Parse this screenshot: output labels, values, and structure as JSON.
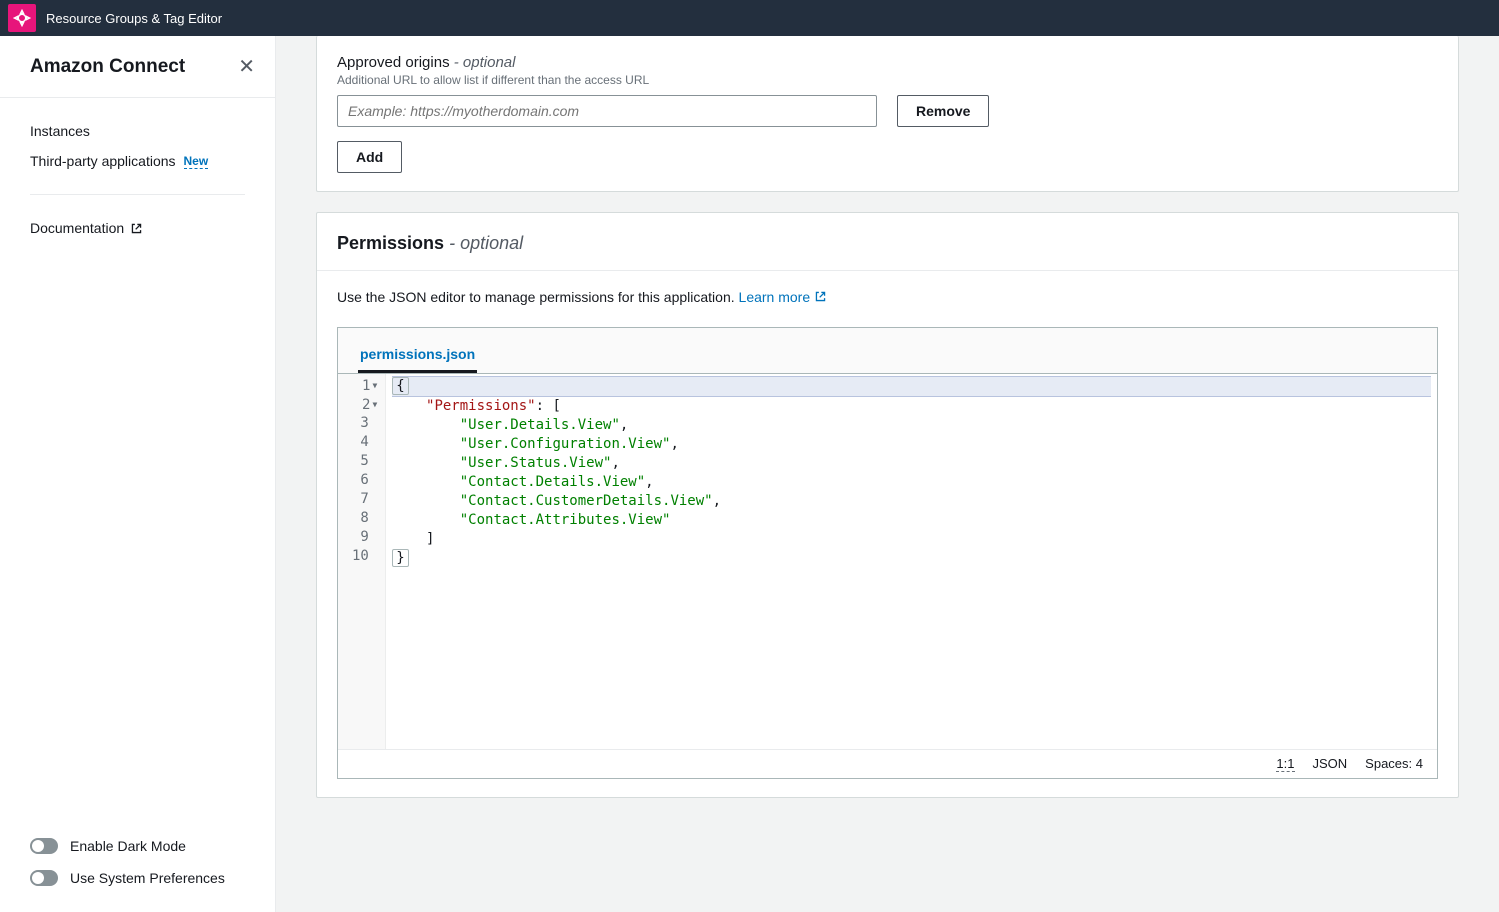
{
  "header": {
    "title": "Resource Groups & Tag Editor"
  },
  "sidebar": {
    "title": "Amazon Connect",
    "items": [
      {
        "label": "Instances"
      },
      {
        "label": "Third-party applications",
        "badge": "New"
      }
    ],
    "doc_label": "Documentation",
    "dark_mode_label": "Enable Dark Mode",
    "system_pref_label": "Use System Preferences"
  },
  "origins": {
    "title": "Approved origins",
    "optional_marker": "- optional",
    "description": "Additional URL to allow list if different than the access URL",
    "placeholder": "Example: https://myotherdomain.com",
    "remove_label": "Remove",
    "add_label": "Add"
  },
  "permissions": {
    "title": "Permissions",
    "optional_marker": "- optional",
    "description_prefix": "Use the JSON editor to manage permissions for this application. ",
    "learn_more": "Learn more",
    "tab_label": "permissions.json",
    "lines": {
      "l1_a": "{",
      "l2_key": "\"Permissions\"",
      "l2_rest": ": [",
      "l3": "\"User.Details.View\"",
      "l4": "\"User.Configuration.View\"",
      "l5": "\"User.Status.View\"",
      "l6": "\"Contact.Details.View\"",
      "l7": "\"Contact.CustomerDetails.View\"",
      "l8": "\"Contact.Attributes.View\"",
      "l9": "]",
      "l10": "}"
    },
    "line_numbers": [
      "1",
      "2",
      "3",
      "4",
      "5",
      "6",
      "7",
      "8",
      "9",
      "10"
    ],
    "status": {
      "pos": "1:1",
      "mode": "JSON",
      "spaces": "Spaces: 4"
    }
  }
}
